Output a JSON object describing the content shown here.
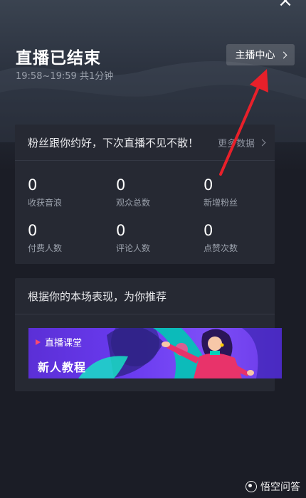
{
  "header": {
    "close_glyph": "×",
    "title": "直播已结束",
    "subtitle": "19:58~19:59 共1分钟",
    "anchor_center_label": "主播中心"
  },
  "stats_card": {
    "title": "粉丝跟你约好，下次直播不见不散！",
    "more_label": "更多数据",
    "items": [
      {
        "value": "0",
        "label": "收获音浪"
      },
      {
        "value": "0",
        "label": "观众总数"
      },
      {
        "value": "0",
        "label": "新增粉丝"
      },
      {
        "value": "0",
        "label": "付费人数"
      },
      {
        "value": "0",
        "label": "评论人数"
      },
      {
        "value": "0",
        "label": "点赞次数"
      }
    ]
  },
  "recommend_card": {
    "title": "根据你的本场表现，为你推荐",
    "banner": {
      "tag": "直播课堂",
      "title": "新人教程"
    }
  },
  "watermark": {
    "text": "悟空问答"
  },
  "colors": {
    "background": "#1b1d26",
    "card": "#262933",
    "annotation_arrow": "#e8202a",
    "banner_purple": "#6a3bf0"
  }
}
